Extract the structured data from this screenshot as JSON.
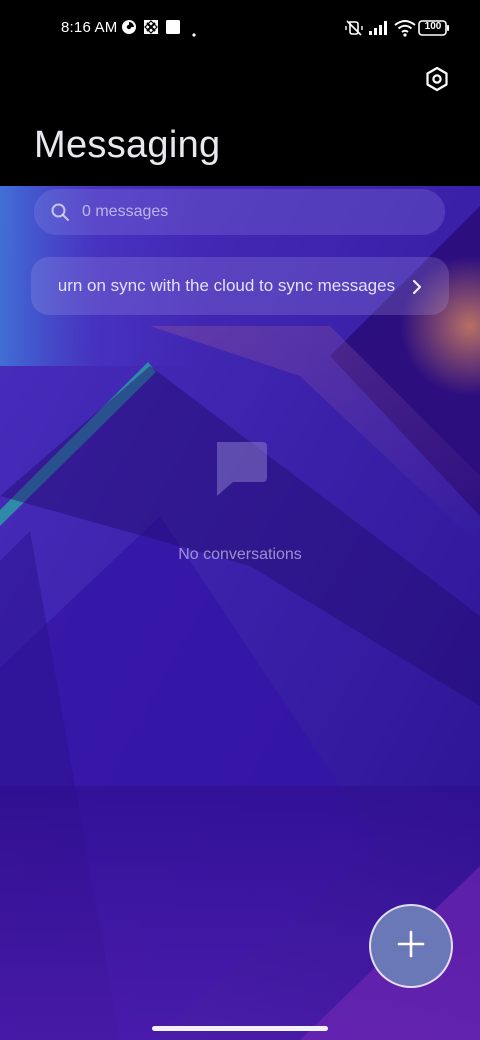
{
  "status_bar": {
    "time": "8:16 AM",
    "battery": "100",
    "icons": [
      "data-saver-icon",
      "app-notification-icon",
      "square-notification-icon",
      "dot-icon",
      "mute-vibrate-icon",
      "signal-icon",
      "wifi-icon",
      "battery-icon"
    ]
  },
  "header": {
    "title": "Messaging",
    "settings_icon": "settings-hexagon-icon"
  },
  "search": {
    "placeholder": "0 messages",
    "icon": "search-icon"
  },
  "sync_banner": {
    "text": "Turn on sync with the cloud to sync messages",
    "icon": "chevron-right-icon"
  },
  "empty_state": {
    "icon": "message-bubble-icon",
    "text": "No conversations"
  },
  "fab": {
    "icon": "plus-icon"
  },
  "colors": {
    "accent": "#6a78b8",
    "header_bg": "#000000",
    "wallpaper_primary": "#2b1280"
  }
}
